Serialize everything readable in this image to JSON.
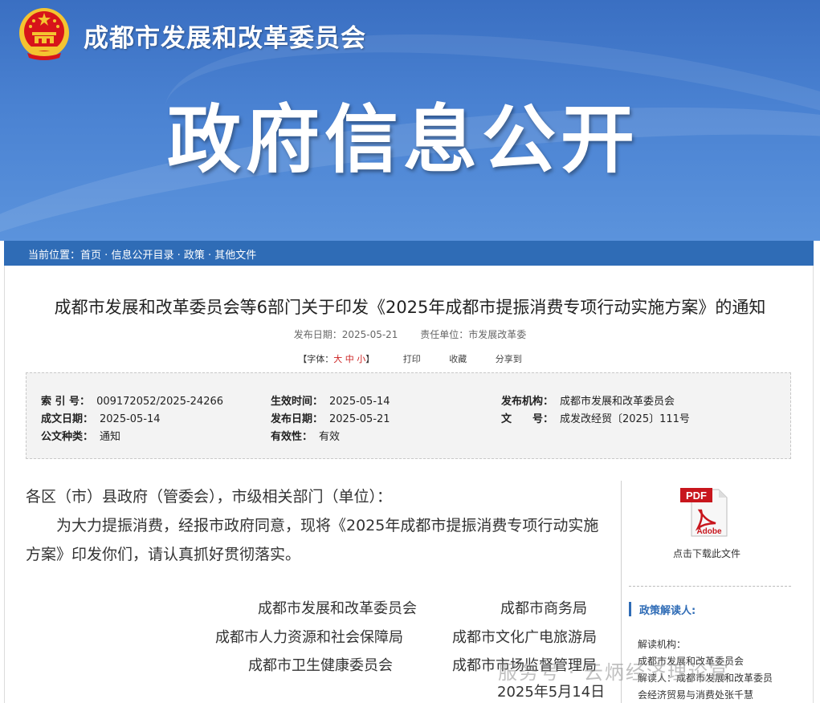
{
  "header": {
    "org_name": "成都市发展和改革委员会",
    "banner_title": "政府信息公开"
  },
  "breadcrumb": {
    "prefix": "当前位置：",
    "items": [
      "首页",
      "信息公开目录",
      "政策",
      "其他文件"
    ],
    "separator": " · "
  },
  "document": {
    "title": "成都市发展和改革委员会等6部门关于印发《2025年成都市提振消费专项行动实施方案》的通知",
    "publish_date": "发布日期：2025-05-21",
    "responsible_unit": "责任单位：市发展改革委",
    "font_size_label": "【字体：",
    "font_big": "大",
    "font_mid": "中",
    "font_small": "小",
    "font_size_end": "】",
    "print": "打印",
    "favorite": "收藏",
    "share": "分享到"
  },
  "info": {
    "index_no_key": "索 引 号：",
    "index_no": "009172052/2025-24266",
    "effective_time_key": "生效时间：",
    "effective_time": "2025-05-14",
    "issuer_key": "发布机构：",
    "issuer": "成都市发展和改革委员会",
    "written_date_key": "成文日期：",
    "written_date": "2025-05-14",
    "publish_date_key": "发布日期：",
    "publish_date": "2025-05-21",
    "doc_no_key": "文　　号：",
    "doc_no": "成发改经贸〔2025〕111号",
    "category_key": "公文种类：",
    "category": "通知",
    "validity_key": "有效性：",
    "validity": "有效"
  },
  "body": {
    "salutation": "各区（市）县政府（管委会），市级相关部门（单位）：",
    "para1_line1": "为大力提振消费，经报市政府同意，现将《2025年成都市提振消费专项行动实施",
    "para1_line2": "方案》印发你们，请认真抓好贯彻落实。",
    "signers": [
      "成都市发展和改革委员会",
      "成都市商务局",
      "成都市人力资源和社会保障局",
      "成都市文化广电旅游局",
      "成都市卫生健康委员会",
      "成都市市场监督管理局"
    ],
    "date": "2025年5月14日"
  },
  "sidebar": {
    "pdf_text": "PDF",
    "adobe_text": "Adobe",
    "download_label": "点击下载此文件",
    "interp_heading": "政策解读人:",
    "interp_org_key": "解读机构：",
    "interp_org": "成都市发展和改革委员会",
    "interp_person": "解读人：成都市发展和改革委员",
    "interp_person2": "会经济贸易与消费处张千慧"
  },
  "watermark": "服务号 · 云炳经济理论官",
  "colors": {
    "banner": "#4a82d2",
    "breadcrumb_bar": "#2f6cb6",
    "emblem_red": "#d7141a",
    "emblem_gold": "#f4c430",
    "pdf_red": "#c8161d"
  }
}
